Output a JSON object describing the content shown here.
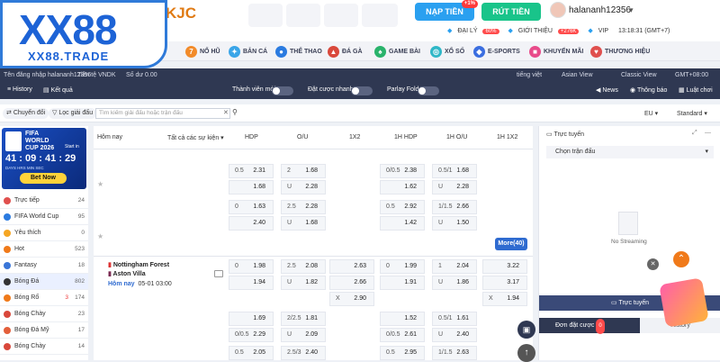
{
  "brand": {
    "logo": "XX88",
    "tagline": "XX88.TRADE",
    "partner": "KJC"
  },
  "header": {
    "deposit": "NẠP TIỀN",
    "deposit_badge": "+1%",
    "withdraw": "RÚT TIỀN",
    "username": "halananh12356",
    "agent": "ĐẠI LÝ",
    "agent_pct": "60%",
    "referral": "GIỚI THIỆU",
    "referral_badge": "+276K",
    "vip": "VIP",
    "clock": "13:18:31 (GMT+7)"
  },
  "nav": [
    "NỔ HŨ",
    "BẮN CÁ",
    "THỂ THAO",
    "ĐÁ GÀ",
    "GAME BÀI",
    "XỔ SỐ",
    "E-SPORTS",
    "KHUYẾN MÃI",
    "THƯƠNG HIỆU"
  ],
  "account": {
    "login": "Tên đăng nhập halananh12356",
    "currency": "Tiền tệ VNDK",
    "balance": "Số dư 0.00",
    "language": "tiếng việt",
    "view1": "Asian View",
    "view2": "Classic View",
    "tz": "GMT+08:00"
  },
  "toolbar": {
    "history": "History",
    "results": "Kết quả",
    "new_member": "Thành viên mới",
    "quick_bet": "Đặt cược nhanh",
    "parlay": "Parlay Fold",
    "news": "News",
    "notice": "Thông báo",
    "rules": "Luật chơi"
  },
  "filters": {
    "switch": "Chuyển đổi",
    "league_filter": "Lọc giải đấu",
    "search_placeholder": "Tìm kiếm giải đấu hoặc trận đấu",
    "odds_region": "EU",
    "odds_mode": "Standard"
  },
  "worldcup": {
    "title1": "FIFA",
    "title2": "WORLD",
    "title3": "CUP 2026",
    "start": "Start in",
    "countdown": "41 : 09 : 41 : 29",
    "labels": "DAYS   HRS   MIN   SEC",
    "button": "Bet Now"
  },
  "sports": [
    {
      "label": "Trực tiếp",
      "count": "24"
    },
    {
      "label": "FIFA World Cup",
      "count": "95"
    },
    {
      "label": "Yêu thích",
      "count": "0"
    },
    {
      "label": "Hot",
      "count": "523"
    },
    {
      "label": "Fantasy",
      "count": "18"
    },
    {
      "label": "Bóng Đá",
      "count": "802"
    },
    {
      "label": "Bóng Rổ",
      "count": "174",
      "live": "3"
    },
    {
      "label": "Bóng Chày",
      "count": "23"
    },
    {
      "label": "Bóng Đá Mỹ",
      "count": "17"
    },
    {
      "label": "Bóng Chày",
      "count": "14"
    }
  ],
  "table": {
    "today": "Hôm nay",
    "all_events": "Tất cả các sự kiện",
    "cols": [
      "HDP",
      "O/U",
      "1X2",
      "1H HDP",
      "1H O/U",
      "1H 1X2"
    ],
    "more": "More(40)",
    "match": {
      "home": "Nottingham Forest",
      "away": "Aston Villa",
      "day": "Hôm nay",
      "time": "05-01 03:00"
    }
  },
  "odds": {
    "r1": [
      "0.5",
      "2.31",
      "2",
      "1.68",
      "0/0.5",
      "2.38",
      "0.5/1",
      "1.68"
    ],
    "r2": [
      "1.68",
      "U",
      "2.28",
      "1.62",
      "U",
      "2.28"
    ],
    "r3": [
      "0",
      "1.63",
      "2.5",
      "2.28",
      "0.5",
      "2.92",
      "1/1.5",
      "2.66"
    ],
    "r4": [
      "2.40",
      "U",
      "1.68",
      "1.42",
      "U",
      "1.50"
    ],
    "m1": [
      "0",
      "1.98",
      "2.5",
      "2.08",
      "2.63",
      "0",
      "1.99",
      "1",
      "2.04",
      "3.22"
    ],
    "m2": [
      "1.94",
      "U",
      "1.82",
      "2.66",
      "1.91",
      "U",
      "1.86",
      "3.17"
    ],
    "m3": [
      "X",
      "2.90",
      "X",
      "1.94"
    ],
    "m4": [
      "1.69",
      "2/2.5",
      "1.81",
      "1.52",
      "0.5/1",
      "1.61"
    ],
    "m5": [
      "0/0.5",
      "2.29",
      "U",
      "2.09",
      "0/0.5",
      "2.61",
      "U",
      "2.40"
    ],
    "m6": [
      "0.5",
      "2.05",
      "2.5/3",
      "2.40",
      "0.5",
      "2.95",
      "1/1.5",
      "2.63"
    ]
  },
  "live": {
    "title": "Trực tuyến",
    "select": "Chọn trận đấu",
    "no_stream": "No Streaming",
    "button": "Trực tuyến",
    "betslip": "Đơn đặt cược",
    "betslip_count": "0",
    "history": "History"
  }
}
